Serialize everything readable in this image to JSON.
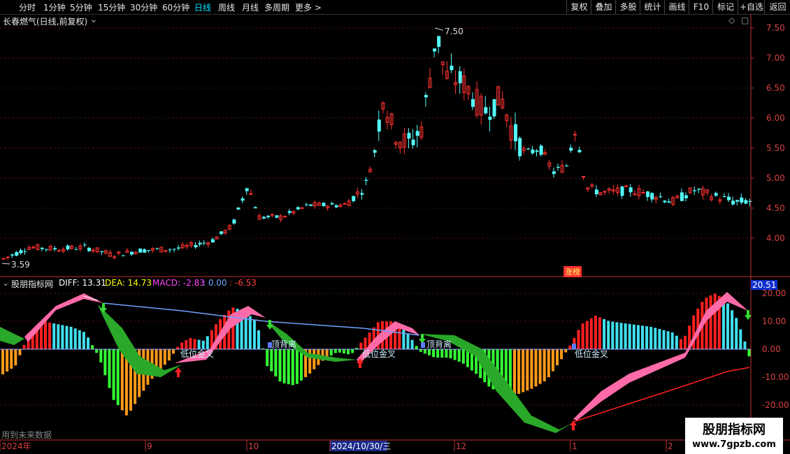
{
  "toolbar": {
    "periods": [
      "分时",
      "1分钟",
      "5分钟",
      "15分钟",
      "30分钟",
      "60分钟",
      "日线",
      "周线",
      "月线",
      "多周期",
      "更多 >"
    ],
    "active_period": "日线",
    "right_buttons": [
      "复权",
      "叠加",
      "多股",
      "统计",
      "画线",
      "F10",
      "标记",
      "+自选",
      "返回"
    ]
  },
  "main_chart": {
    "title": "长春燃气(日线,前复权)",
    "y_ticks": [
      "7.50",
      "7.00",
      "6.50",
      "6.00",
      "5.50",
      "5.00",
      "4.50",
      "4.00"
    ],
    "high_label": "7.50",
    "low_label": "3.59",
    "badge": "涨榜"
  },
  "indicator": {
    "name": "股朋指标网",
    "diff_label": "DIFF: 13.31",
    "dea_label": "DEA: 14.73",
    "macd_label": "MACD: -2.83",
    "extra_label": ": 0.00",
    "extra2_label": ": -6.53",
    "current_value": "20.51",
    "y_ticks": [
      "20.00",
      "10.00",
      "0.00",
      "-10.00",
      "-20.00"
    ],
    "annotations": [
      "低位金叉",
      "顶背离",
      "低位金叉",
      "顶背离",
      "低位金叉"
    ],
    "footer_note": "用到未来数据"
  },
  "x_axis": {
    "labels": [
      "2024年",
      "9",
      "10",
      "2024/10/30/三",
      "12",
      "1",
      "2"
    ]
  },
  "watermark": {
    "title": "股朋指标网",
    "url": "www.7gpzb.com"
  },
  "colors": {
    "up": "#ff3232",
    "down": "#54ffff",
    "macd_pos_red": "#ff2020",
    "macd_pos_cyan": "#40e0f0",
    "macd_neg_green": "#33ff33",
    "macd_neg_orange": "#ff9a1a",
    "pink_band": "#ff6aa8",
    "green_band": "#2aa82a"
  },
  "chart_data": {
    "type": "candlestick",
    "title": "长春燃气(日线,前复权)",
    "price_range": [
      3.5,
      7.6
    ],
    "notable_points": {
      "high": 7.5,
      "low": 3.59
    },
    "indicator_range": [
      -22,
      22
    ]
  }
}
